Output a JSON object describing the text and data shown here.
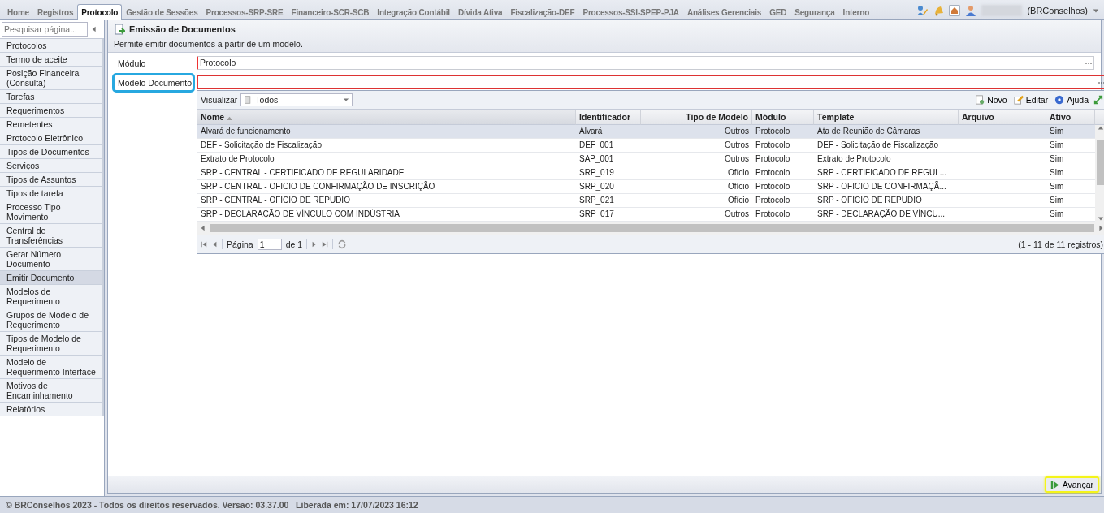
{
  "top_tabs": [
    {
      "label": "Home",
      "selected": false
    },
    {
      "label": "Registros",
      "selected": false
    },
    {
      "label": "Protocolo",
      "selected": true
    },
    {
      "label": "Gestão de Sessões",
      "selected": false
    },
    {
      "label": "Processos-SRP-SRE",
      "selected": false
    },
    {
      "label": "Financeiro-SCR-SCB",
      "selected": false
    },
    {
      "label": "Integração Contábil",
      "selected": false
    },
    {
      "label": "Dívida Ativa",
      "selected": false
    },
    {
      "label": "Fiscalização-DEF",
      "selected": false
    },
    {
      "label": "Processos-SSI-SPEP-PJA",
      "selected": false
    },
    {
      "label": "Análises Gerenciais",
      "selected": false
    },
    {
      "label": "GED",
      "selected": false
    },
    {
      "label": "Segurança",
      "selected": false
    },
    {
      "label": "Interno",
      "selected": false
    }
  ],
  "user": {
    "organization": "(BRConselhos)"
  },
  "sidebar": {
    "search_placeholder": "Pesquisar página...",
    "items": [
      {
        "label": "Protocolos",
        "selected": false
      },
      {
        "label": "Termo de aceite",
        "selected": false
      },
      {
        "label": "Posição Financeira (Consulta)",
        "selected": false
      },
      {
        "label": "Tarefas",
        "selected": false
      },
      {
        "label": "Requerimentos",
        "selected": false
      },
      {
        "label": "Remetentes",
        "selected": false
      },
      {
        "label": "Protocolo Eletrônico",
        "selected": false
      },
      {
        "label": "Tipos de Documentos",
        "selected": false
      },
      {
        "label": "Serviços",
        "selected": false
      },
      {
        "label": "Tipos de Assuntos",
        "selected": false
      },
      {
        "label": "Tipos de tarefa",
        "selected": false
      },
      {
        "label": "Processo Tipo Movimento",
        "selected": false
      },
      {
        "label": "Central de Transferências",
        "selected": false
      },
      {
        "label": "Gerar Número Documento",
        "selected": false
      },
      {
        "label": "Emitir Documento",
        "selected": true
      },
      {
        "label": "Modelos de Requerimento",
        "selected": false
      },
      {
        "label": "Grupos de Modelo de Requerimento",
        "selected": false
      },
      {
        "label": "Tipos de Modelo de Requerimento",
        "selected": false
      },
      {
        "label": "Modelo de Requerimento Interface",
        "selected": false
      },
      {
        "label": "Motivos de Encaminhamento",
        "selected": false
      },
      {
        "label": "Relatórios",
        "selected": false
      }
    ]
  },
  "panel": {
    "title": "Emissão de Documentos",
    "description": "Permite emitir documentos a partir de um modelo.",
    "fields": [
      {
        "label": "Módulo",
        "value": "Protocolo",
        "highlighted": false
      },
      {
        "label": "Modelo Documento",
        "highlighted": true
      }
    ]
  },
  "picker": {
    "view_label": "Visualizar",
    "view_value": "Todos",
    "toolbar": [
      "Novo",
      "Editar",
      "Ajuda"
    ],
    "columns": [
      {
        "label": "Nome",
        "sorted": true
      },
      {
        "label": "Identificador",
        "sorted": false
      },
      {
        "label": "Tipo de Modelo",
        "sorted": false
      },
      {
        "label": "Módulo",
        "sorted": false
      },
      {
        "label": "Template",
        "sorted": false
      },
      {
        "label": "Arquivo",
        "sorted": false
      },
      {
        "label": "Ativo",
        "sorted": false
      }
    ],
    "rows": [
      {
        "selected": true,
        "cells": [
          "Alvará de funcionamento",
          "Alvará",
          "Outros",
          "Protocolo",
          "Ata de Reunião de Câmaras",
          "",
          "Sim"
        ]
      },
      {
        "selected": false,
        "cells": [
          "DEF - Solicitação de Fiscalização",
          "DEF_001",
          "Outros",
          "Protocolo",
          "DEF - Solicitação de Fiscalização",
          "",
          "Sim"
        ]
      },
      {
        "selected": false,
        "cells": [
          "Extrato de Protocolo",
          "SAP_001",
          "Outros",
          "Protocolo",
          "Extrato de Protocolo",
          "",
          "Sim"
        ]
      },
      {
        "selected": false,
        "cells": [
          "SRP - CENTRAL - CERTIFICADO DE REGULARIDADE",
          "SRP_019",
          "Ofício",
          "Protocolo",
          "SRP - CERTIFICADO DE REGUL...",
          "",
          "Sim"
        ]
      },
      {
        "selected": false,
        "cells": [
          "SRP - CENTRAL - OFICIO DE CONFIRMAÇÃO DE INSCRIÇÃO",
          "SRP_020",
          "Ofício",
          "Protocolo",
          "SRP - OFICIO DE CONFIRMAÇÃ...",
          "",
          "Sim"
        ]
      },
      {
        "selected": false,
        "cells": [
          "SRP - CENTRAL - OFICIO DE REPUDIO",
          "SRP_021",
          "Ofício",
          "Protocolo",
          "SRP - OFICIO DE REPUDIO",
          "",
          "Sim"
        ]
      },
      {
        "selected": false,
        "cells": [
          "SRP - DECLARAÇÃO DE VÍNCULO COM INDÚSTRIA",
          "SRP_017",
          "Outros",
          "Protocolo",
          "SRP - DECLARAÇÃO DE VÍNCU...",
          "",
          "Sim"
        ]
      }
    ],
    "pager": {
      "page_label": "Página",
      "page": "1",
      "of": "de 1",
      "summary": "(1 - 11 de 11 registros)"
    }
  },
  "next_button": {
    "label": "Avançar",
    "highlighted": true
  },
  "footer": "© BRConselhos 2023 - Todos os direitos reservados. Versão: 03.37.00   Liberada em: 17/07/2023 16:12"
}
